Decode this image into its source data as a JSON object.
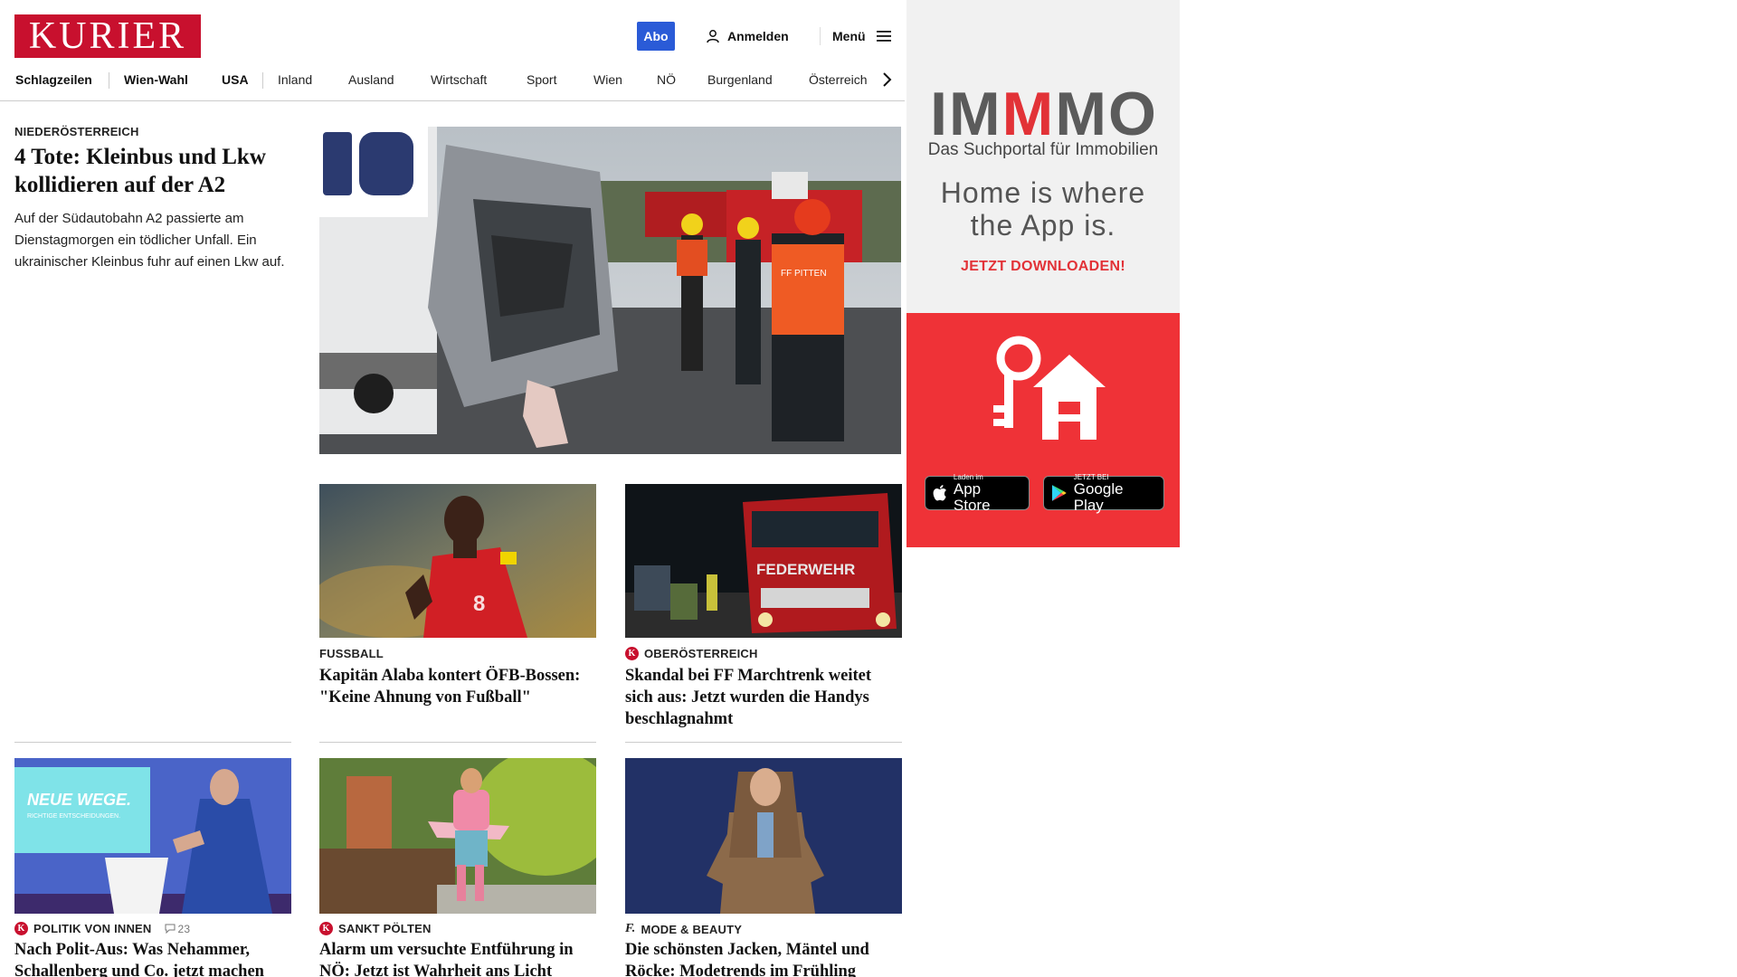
{
  "header": {
    "logo": "KURIER",
    "abo_label": "Abo",
    "login_label": "Anmelden",
    "menu_label": "Menü"
  },
  "nav": {
    "items": [
      "Schlagzeilen",
      "Wien-Wahl",
      "USA",
      "Inland",
      "Ausland",
      "Wirtschaft",
      "Sport",
      "Wien",
      "NÖ",
      "Burgenland",
      "Österreich"
    ]
  },
  "lead": {
    "kicker": "NIEDERÖSTERREICH",
    "title": "4 Tote: Kleinbus und Lkw kollidieren auf der A2",
    "teaser": "Auf der Südautobahn A2 passierte am Dienstagmorgen ein tödlicher Unfall. Ein ukrainischer Kleinbus fuhr auf einen Lkw auf."
  },
  "cards": [
    {
      "kicker": "FUSSBALL",
      "title": "Kapitän Alaba kontert ÖFB-Bossen: \"Keine Ahnung von Fußball\""
    },
    {
      "kicker": "OBERÖSTERREICH",
      "badge": "K",
      "title": "Skandal bei FF Marchtrenk weitet sich aus: Jetzt wurden die Handys beschlagnahmt"
    },
    {
      "kicker": "POLITIK VON INNEN",
      "badge": "K",
      "comments": "23",
      "title": "Nach Polit-Aus: Was Nehammer, Schallenberg und Co. jetzt machen"
    },
    {
      "kicker": "SANKT PÖLTEN",
      "badge": "K",
      "title": "Alarm um versuchte Entführung in NÖ: Jetzt ist Wahrheit ans Licht gekommen"
    },
    {
      "kicker": "MODE & BEAUTY",
      "badge": "f.",
      "title": "Die schönsten Jacken, Mäntel und Röcke: Modetrends im Frühling"
    }
  ],
  "images": {
    "lead_sign": "FF PITTEN",
    "truck_text": "FEDERWEHR",
    "podium_text": "NEUE WEGE.",
    "podium_sub": "RICHTIGE ENTSCHEIDUNGEN."
  },
  "ad": {
    "logo_parts": [
      "IM",
      "M",
      "MO"
    ],
    "subtitle": "Das Suchportal für Immobilien",
    "headline": "Home is where the App is.",
    "cta": "JETZT DOWNLOADEN!",
    "appstore_small": "Laden im",
    "appstore_big": "App Store",
    "googleplay_small": "JETZT BEI",
    "googleplay_big": "Google Play"
  },
  "colors": {
    "brand_red": "#c8102e",
    "abo_blue": "#2a5bd7",
    "ad_red": "#ef3237"
  }
}
